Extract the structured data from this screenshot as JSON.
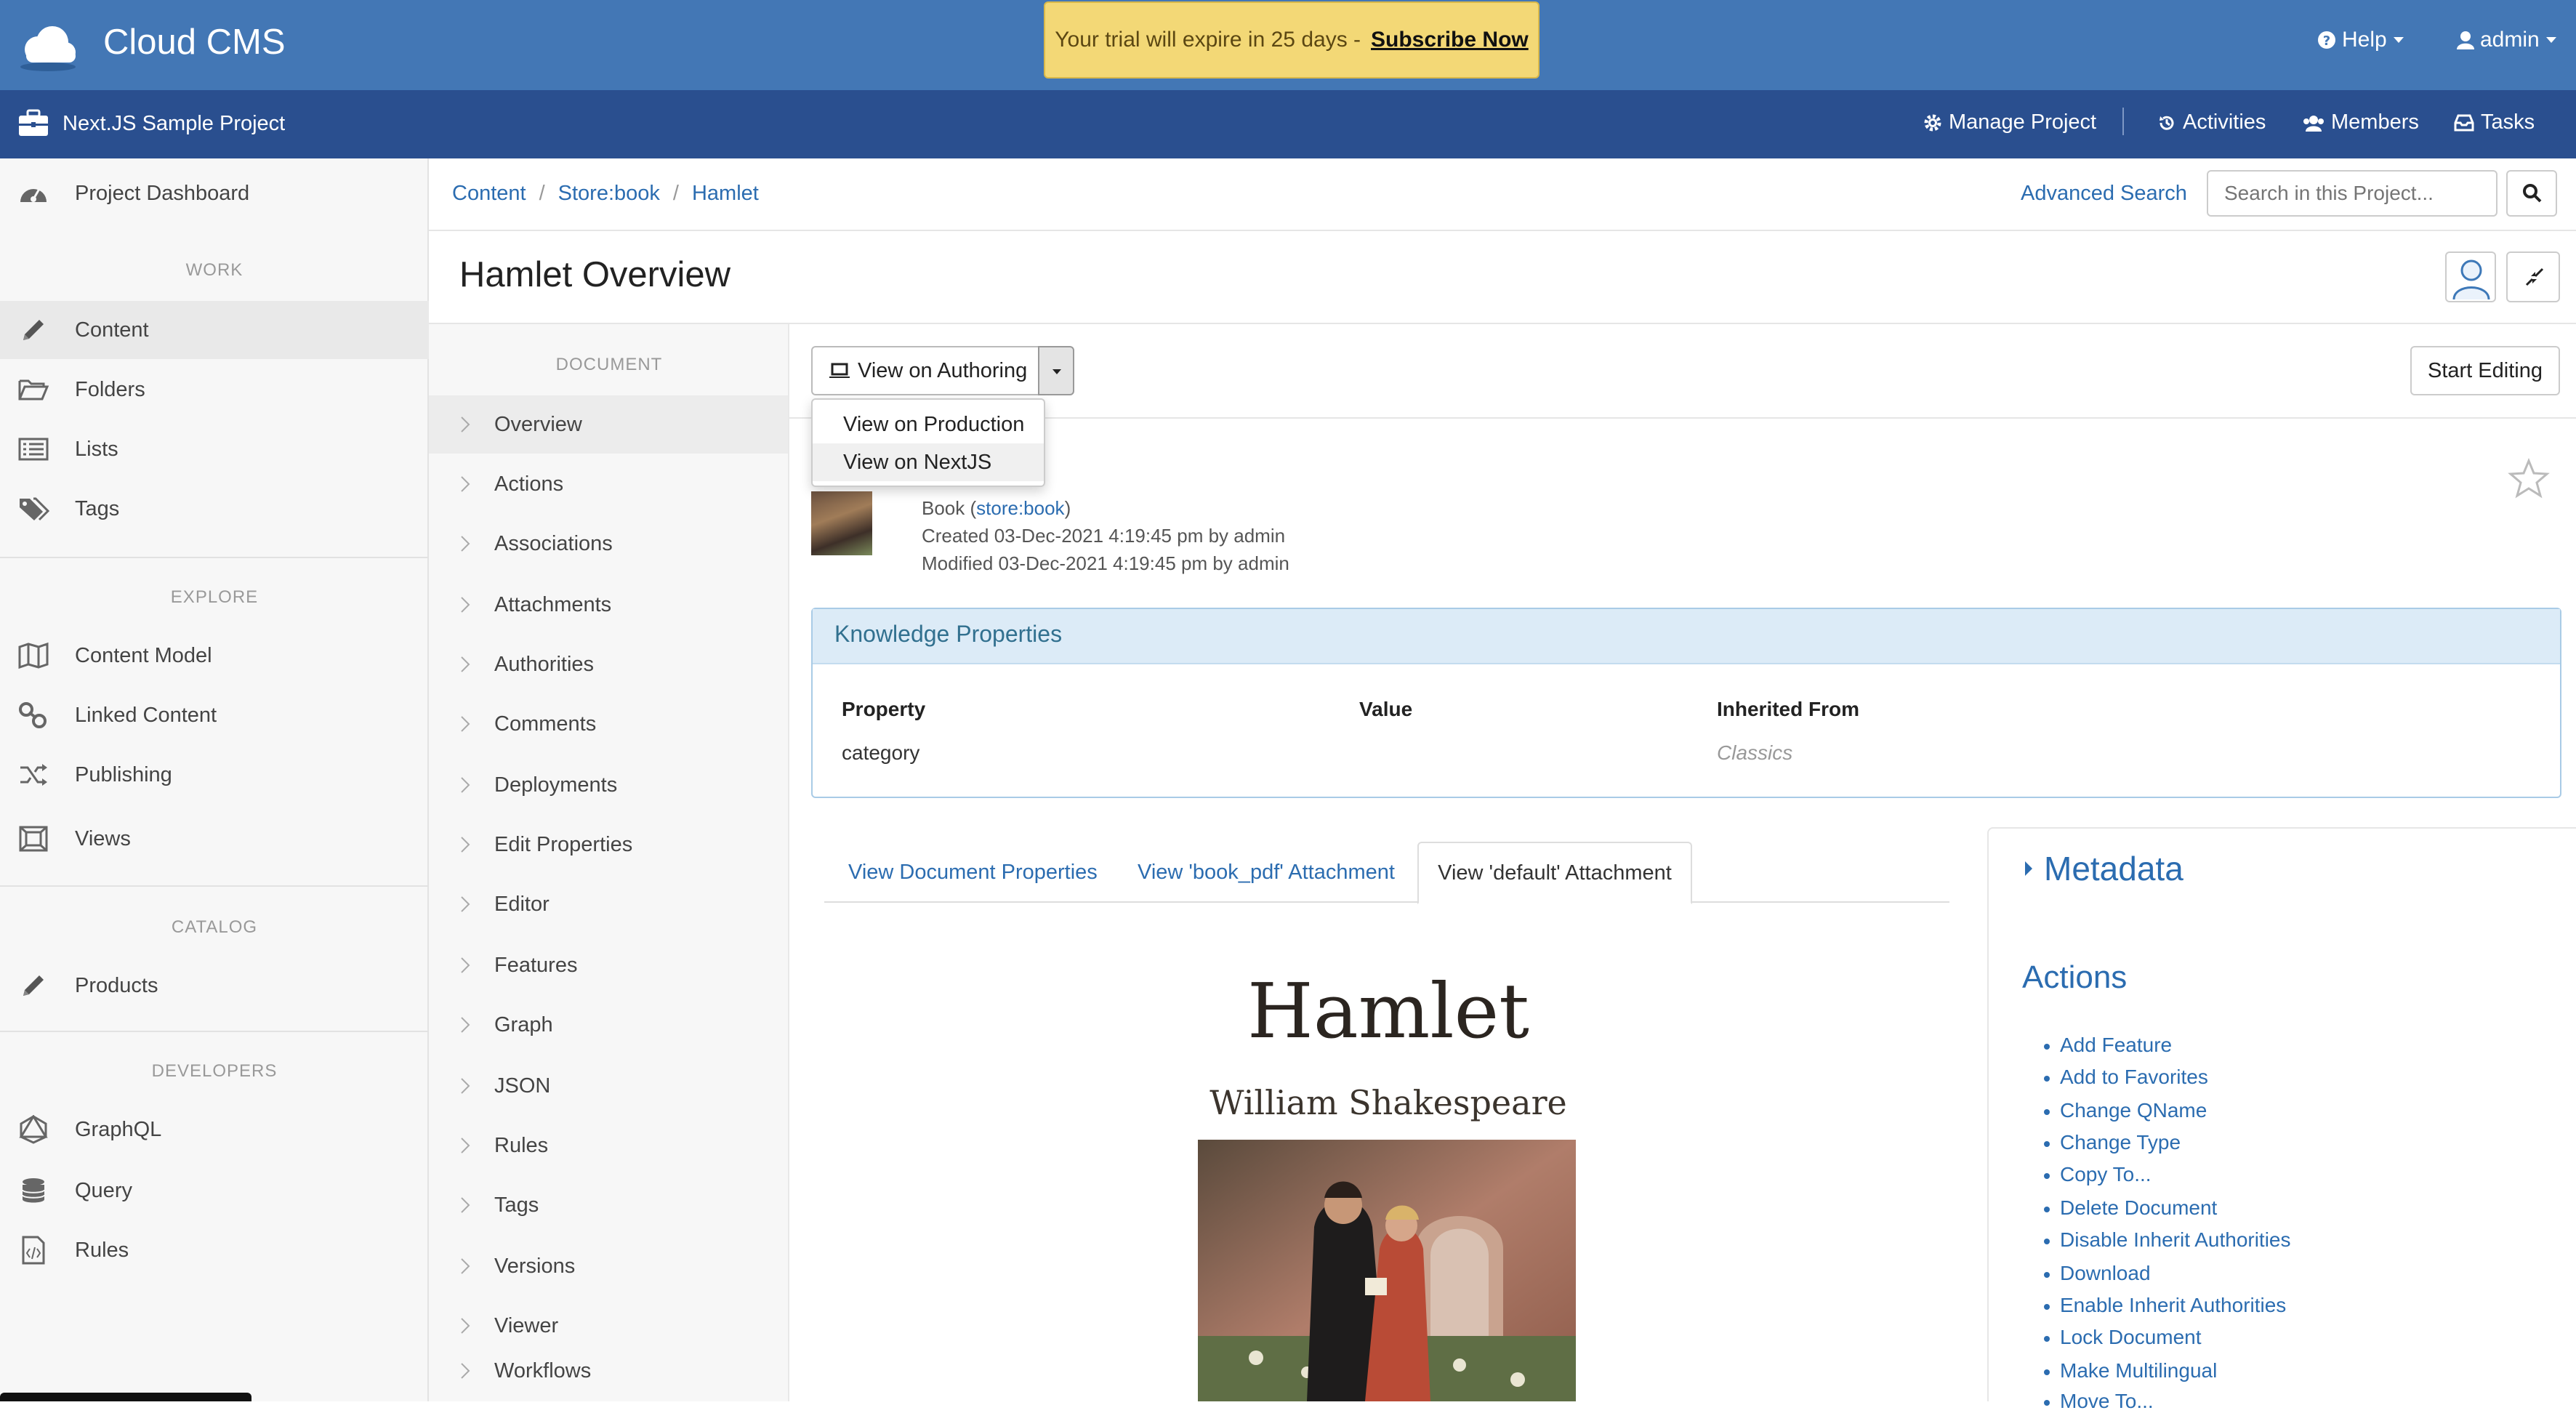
{
  "app": {
    "title": "Cloud CMS"
  },
  "trial": {
    "text": "Your trial will expire in 25 days  -",
    "link": "Subscribe Now"
  },
  "top_nav": {
    "help": "Help",
    "user": "admin"
  },
  "project": {
    "title": "Next.JS Sample Project",
    "nav": {
      "manage": "Manage Project",
      "activities": "Activities",
      "members": "Members",
      "tasks": "Tasks"
    }
  },
  "sidebar": {
    "dashboard": "Project Dashboard",
    "sections": {
      "work": "WORK",
      "explore": "EXPLORE",
      "catalog": "CATALOG",
      "developers": "DEVELOPERS"
    },
    "items": {
      "content": "Content",
      "folders": "Folders",
      "lists": "Lists",
      "tags": "Tags",
      "content_model": "Content Model",
      "linked_content": "Linked Content",
      "publishing": "Publishing",
      "views": "Views",
      "products": "Products",
      "graphql": "GraphQL",
      "query": "Query",
      "rules": "Rules"
    }
  },
  "breadcrumb": [
    "Content",
    "Store:book",
    "Hamlet"
  ],
  "search": {
    "advanced": "Advanced Search",
    "placeholder": "Search in this Project..."
  },
  "page": {
    "title": "Hamlet Overview"
  },
  "doc_nav": {
    "heading": "DOCUMENT",
    "items": [
      "Overview",
      "Actions",
      "Associations",
      "Attachments",
      "Authorities",
      "Comments",
      "Deployments",
      "Edit Properties",
      "Editor",
      "Features",
      "Graph",
      "JSON",
      "Rules",
      "Tags",
      "Versions",
      "Viewer",
      "Workflows"
    ]
  },
  "toolbar": {
    "view": "View on Authoring",
    "start_editing": "Start Editing"
  },
  "dropdown": {
    "items": [
      "View on Production",
      "View on NextJS"
    ]
  },
  "document": {
    "type_label": "Book (",
    "type_qname": "store:book",
    "type_close": ")",
    "created": "Created 03-Dec-2021 4:19:45 pm by admin",
    "modified": "Modified 03-Dec-2021 4:19:45 pm by admin"
  },
  "knowledge": {
    "title": "Knowledge Properties",
    "headers": {
      "property": "Property",
      "value": "Value",
      "inherited": "Inherited From"
    },
    "row": {
      "property": "category",
      "value": "",
      "inherited": "Classics"
    }
  },
  "tabs": [
    "View Document Properties",
    "View 'book_pdf' Attachment",
    "View 'default' Attachment"
  ],
  "cover": {
    "title": "Hamlet",
    "author": "William Shakespeare"
  },
  "right_panel": {
    "metadata": "Metadata",
    "actions_title": "Actions",
    "actions": [
      "Add Feature",
      "Add to Favorites",
      "Change QName",
      "Change Type",
      "Copy To...",
      "Delete Document",
      "Disable Inherit Authorities",
      "Download",
      "Enable Inherit Authorities",
      "Lock Document",
      "Make Multilingual",
      "Move To..."
    ]
  },
  "colors": {
    "topbar": "#4377b5",
    "projbar": "#2a4f8f",
    "link": "#2b6cb0",
    "trial": "#f3d876",
    "panel_head": "#dcebf7"
  }
}
